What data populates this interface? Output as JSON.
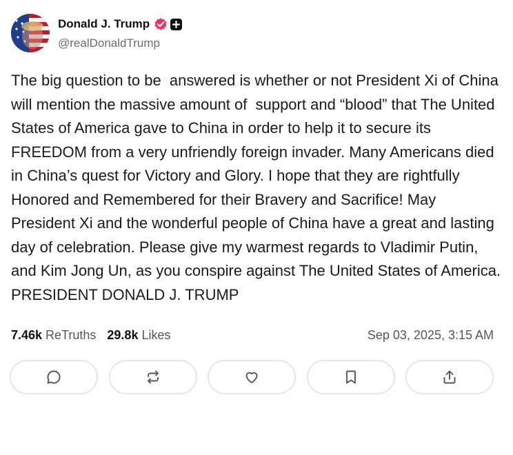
{
  "author": {
    "display_name": "Donald J. Trump",
    "handle": "@realDonaldTrump",
    "verified_color": "#e8356b"
  },
  "post": {
    "text": "The big question to be  answered is whether or not President Xi of China will mention the massive amount of  support and “blood” that The United States of America gave to China in order to help it to secure its FREEDOM from a very unfriendly foreign invader. Many Americans died in China’s quest for Victory and Glory. I hope that they are rightfully Honored and Remembered for their Bravery and Sacrifice! May President Xi and the wonderful people of China have a great and lasting day of celebration. Please give my warmest regards to Vladimir Putin, and Kim Jong Un, as you conspire against The United States of America. PRESIDENT DONALD J. TRUMP"
  },
  "stats": {
    "retruths_count": "7.46k",
    "retruths_label": "ReTruths",
    "likes_count": "29.8k",
    "likes_label": "Likes",
    "timestamp": "Sep 03, 2025, 3:15 AM"
  },
  "actions": [
    {
      "icon": "reply-icon"
    },
    {
      "icon": "retruth-icon"
    },
    {
      "icon": "like-icon"
    },
    {
      "icon": "bookmark-icon"
    },
    {
      "icon": "share-icon"
    }
  ]
}
